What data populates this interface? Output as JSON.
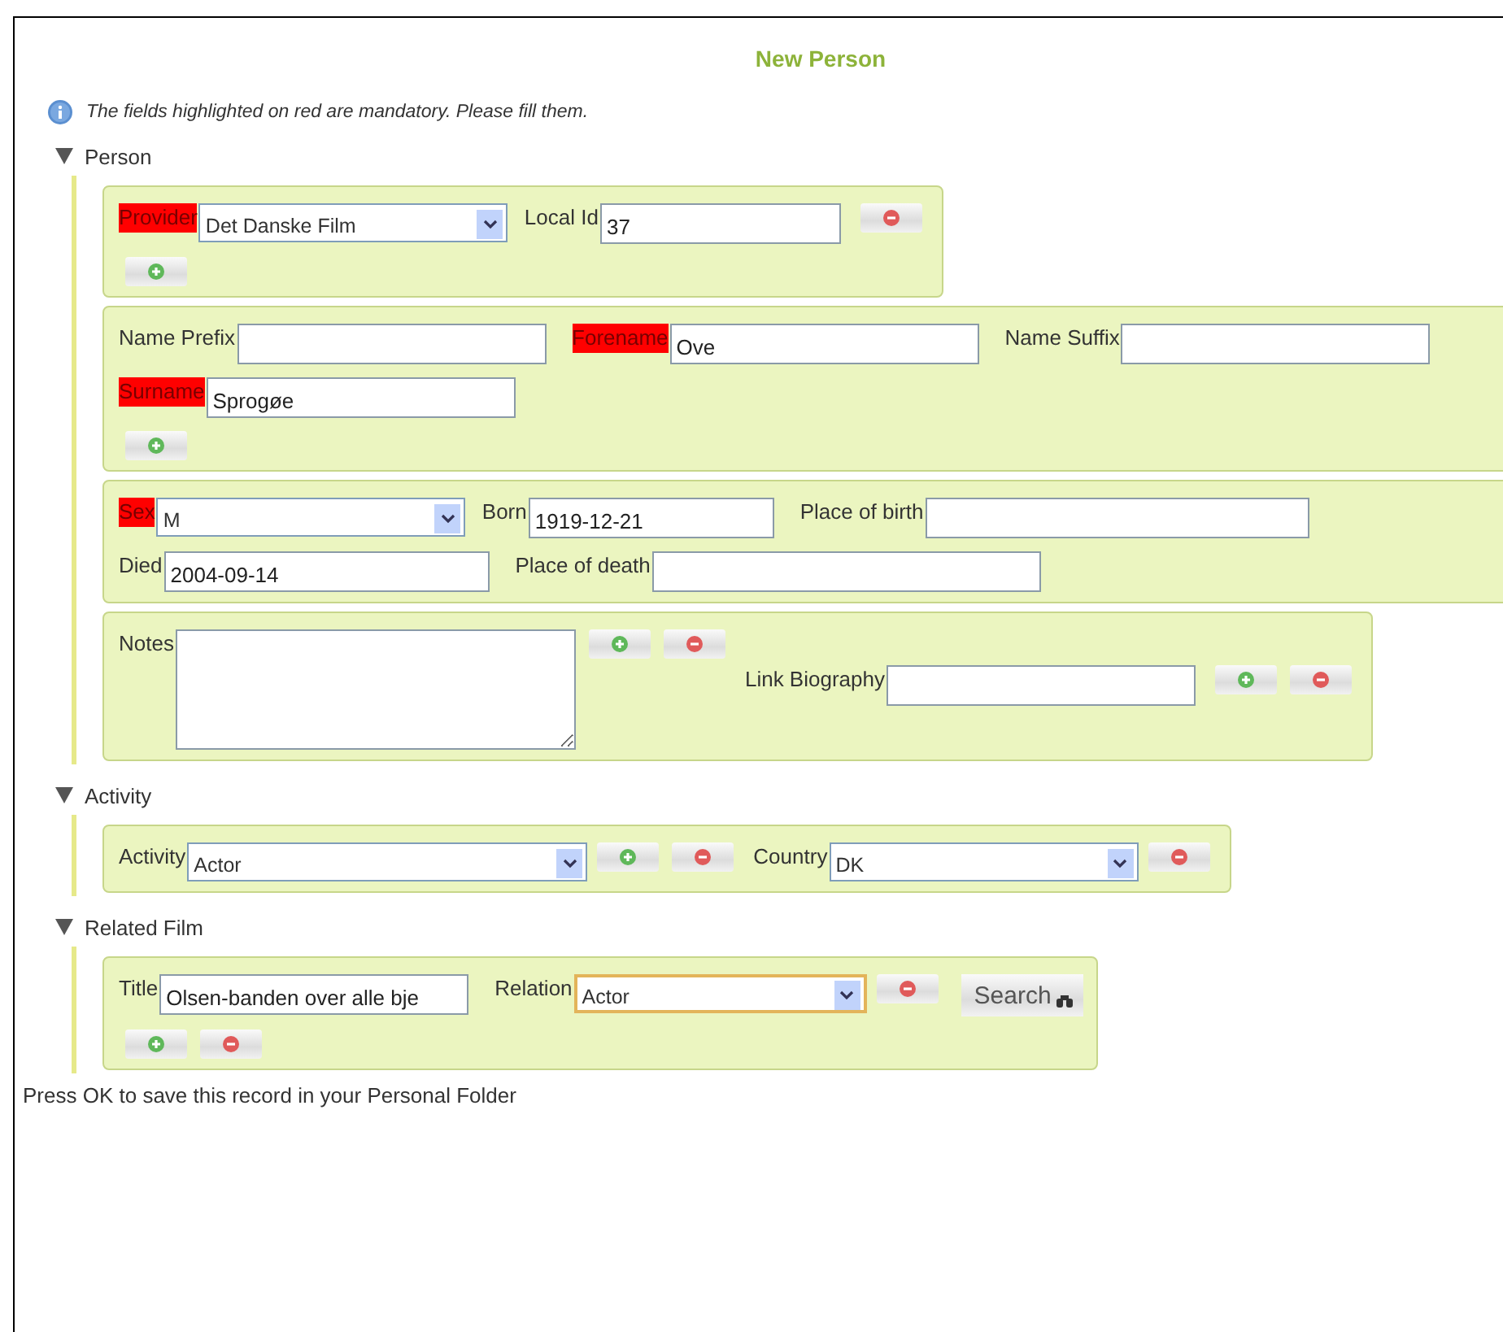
{
  "title": "New Person",
  "info": "The fields highlighted on red are mandatory. Please fill them.",
  "sections": [
    {
      "title": "Person",
      "expanded": true,
      "panels": [
        {
          "rows": [
            [
              {
                "kind": "label",
                "text": "Provider",
                "required": true
              },
              {
                "kind": "select",
                "value": "Det Danske Film",
                "focused": false
              },
              {
                "kind": "label",
                "text": "Local Id",
                "required": false
              },
              {
                "kind": "input",
                "value": "37"
              },
              {
                "kind": "remove"
              }
            ],
            [
              {
                "kind": "add"
              }
            ]
          ]
        },
        {
          "rows": [
            [
              {
                "kind": "label",
                "text": "Name Prefix",
                "required": false
              },
              {
                "kind": "input"
              },
              {
                "kind": "label",
                "text": "Forename",
                "required": true
              },
              {
                "kind": "input",
                "value": "Ove"
              },
              {
                "kind": "label",
                "text": "Name Suffix",
                "required": false
              },
              {
                "kind": "input"
              }
            ],
            [
              {
                "kind": "label",
                "text": "Surname",
                "required": true
              },
              {
                "kind": "input",
                "value": "Sprogøe"
              }
            ],
            [
              {
                "kind": "add"
              }
            ]
          ]
        },
        {
          "rows": [
            [
              {
                "kind": "label",
                "text": "Sex",
                "required": true
              },
              {
                "kind": "select",
                "value": "M",
                "focused": false
              },
              {
                "kind": "label",
                "text": "Born",
                "required": false
              },
              {
                "kind": "input",
                "value": "1919-12-21"
              },
              {
                "kind": "label",
                "text": "Place of birth",
                "required": false
              },
              {
                "kind": "input"
              }
            ],
            [
              {
                "kind": "label",
                "text": "Died",
                "required": false
              },
              {
                "kind": "input",
                "value": "2004-09-14"
              },
              {
                "kind": "label",
                "text": "Place of death",
                "required": false
              },
              {
                "kind": "input"
              }
            ]
          ]
        },
        {
          "rows": [
            [
              {
                "kind": "label",
                "text": "Notes",
                "required": false
              },
              {
                "kind": "textarea"
              },
              {
                "kind": "add"
              },
              {
                "kind": "remove"
              },
              {
                "kind": "label",
                "text": "Link Biography",
                "required": false
              },
              {
                "kind": "input"
              },
              {
                "kind": "add"
              },
              {
                "kind": "remove"
              }
            ]
          ]
        }
      ]
    },
    {
      "title": "Activity",
      "expanded": true,
      "panels": [
        {
          "rows": [
            [
              {
                "kind": "label",
                "text": "Activity",
                "required": false
              },
              {
                "kind": "select",
                "value": "Actor",
                "focused": false
              },
              {
                "kind": "add"
              },
              {
                "kind": "remove"
              },
              {
                "kind": "label",
                "text": "Country",
                "required": false
              },
              {
                "kind": "select",
                "value": "DK",
                "focused": false
              },
              {
                "kind": "remove"
              }
            ]
          ]
        }
      ]
    },
    {
      "title": "Related Film",
      "expanded": true,
      "panels": [
        {
          "rows": [
            [
              {
                "kind": "label",
                "text": "Title",
                "required": false
              },
              {
                "kind": "input",
                "value": "Olsen-banden over alle bje"
              },
              {
                "kind": "label",
                "text": "Relation",
                "required": false
              },
              {
                "kind": "select",
                "value": "Actor",
                "focused": true
              },
              {
                "kind": "remove"
              },
              {
                "kind": "search",
                "text": "Search"
              }
            ],
            [
              {
                "kind": "add"
              },
              {
                "kind": "remove"
              }
            ]
          ]
        }
      ]
    }
  ],
  "footer": "Press OK to save this record in your Personal Folder"
}
